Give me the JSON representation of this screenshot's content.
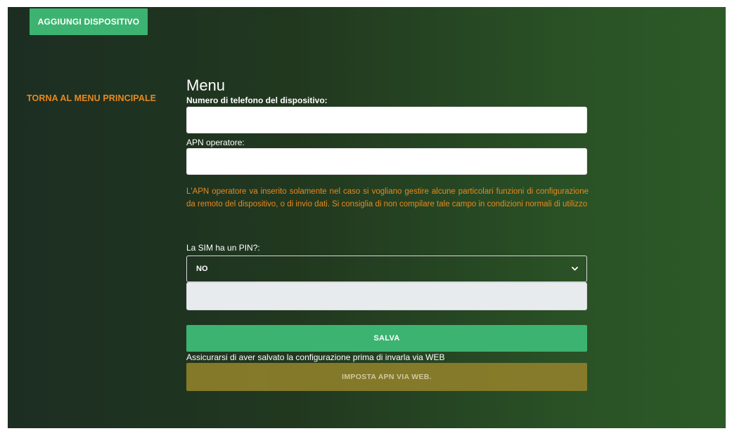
{
  "header": {
    "add_device_label": "AGGIUNGI DISPOSITIVO"
  },
  "sidebar": {
    "back_link_label": "TORNA AL MENU PRINCIPALE"
  },
  "form": {
    "title": "Menu",
    "phone_label": "Numero di telefono del dispositivo:",
    "phone_value": "",
    "apn_label": "APN operatore:",
    "apn_value": "",
    "apn_notice": "L'APN operatore va inserito solamente nel caso si vogliano gestire alcune particolari funzioni di configurazione da remoto del dispositivo, o di invio dati. Si consiglia di non compilare tale campo in condizioni normali di utilizzo",
    "pin_label": "La SIM ha un PIN?:",
    "pin_selected": "NO",
    "pin_value": "",
    "save_label": "SALVA",
    "save_note": "Assicurarsi di aver salvato la configurazione prima di invarla via WEB",
    "apn_web_label": "IMPOSTA APN VIA WEB."
  },
  "colors": {
    "accent_green": "#3cb371",
    "warning_orange": "#e8891f",
    "disabled_olive": "#8a7d2a"
  },
  "icons": {
    "select_arrow": "chevron-down-icon"
  }
}
